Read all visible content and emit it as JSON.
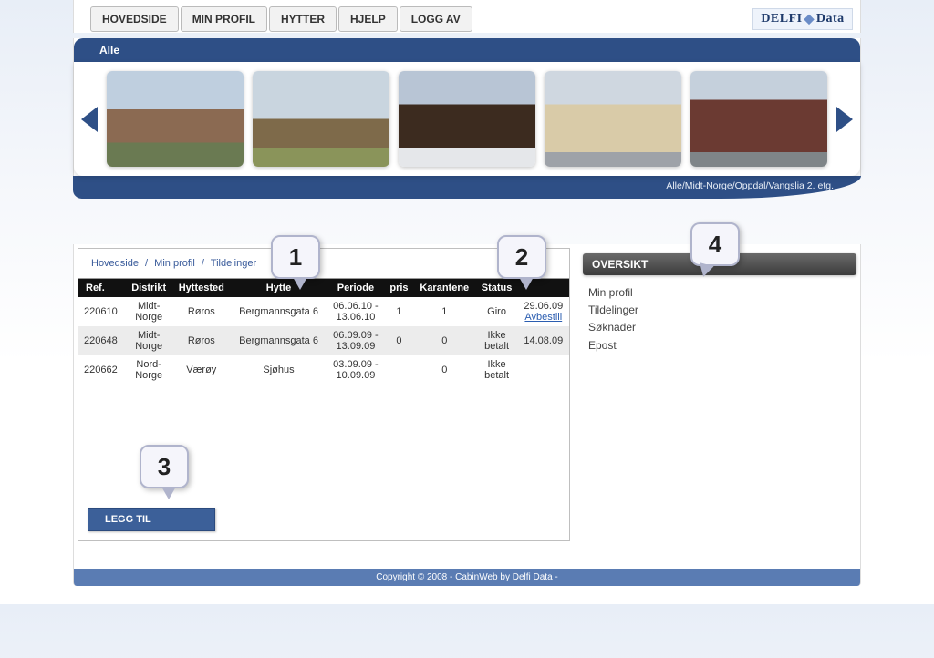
{
  "nav": {
    "hovedside": "HOVEDSIDE",
    "min_profil": "MIN PROFIL",
    "hytter": "HYTTER",
    "hjelp": "HJELP",
    "logg_av": "LOGG AV"
  },
  "logo": {
    "part1": "DELFI",
    "part2": "Data"
  },
  "tab": {
    "alle": "Alle"
  },
  "subbar": "Alle/Midt-Norge/Oppdal/Vangslia 2. etg.",
  "breadcrumb": {
    "a": "Hovedside",
    "b": "Min profil",
    "c": "Tildelinger",
    "sep": "/"
  },
  "table": {
    "headers": {
      "ref": "Ref.",
      "distrikt": "Distrikt",
      "hyttested": "Hyttested",
      "hytte": "Hytte",
      "periode": "Periode",
      "pris": "pris",
      "karantene": "Karantene",
      "status": "Status",
      "last": ""
    },
    "rows": [
      {
        "ref": "220610",
        "distrikt": "Midt-Norge",
        "hyttested": "Røros",
        "hytte": "Bergmannsgata 6",
        "periode": "06.06.10 - 13.06.10",
        "pris": "1",
        "karantene": "1",
        "status": "Giro",
        "last_date": "29.06.09",
        "last_action": "Avbestill"
      },
      {
        "ref": "220648",
        "distrikt": "Midt-Norge",
        "hyttested": "Røros",
        "hytte": "Bergmannsgata 6",
        "periode": "06.09.09 - 13.09.09",
        "pris": "0",
        "karantene": "0",
        "status": "Ikke betalt",
        "last_date": "14.08.09",
        "last_action": ""
      },
      {
        "ref": "220662",
        "distrikt": "Nord-Norge",
        "hyttested": "Værøy",
        "hytte": "Sjøhus",
        "periode": "03.09.09 - 10.09.09",
        "pris": "",
        "karantene": "0",
        "status": "Ikke betalt",
        "last_date": "",
        "last_action": ""
      }
    ]
  },
  "legg_til": "LEGG TIL",
  "oversikt": {
    "title": "OVERSIKT",
    "items": [
      "Min profil",
      "Tildelinger",
      "Søknader",
      "Epost"
    ]
  },
  "callouts": {
    "c1": "1",
    "c2": "2",
    "c3": "3",
    "c4": "4"
  },
  "footer": "Copyright © 2008 - CabinWeb by Delfi Data -"
}
